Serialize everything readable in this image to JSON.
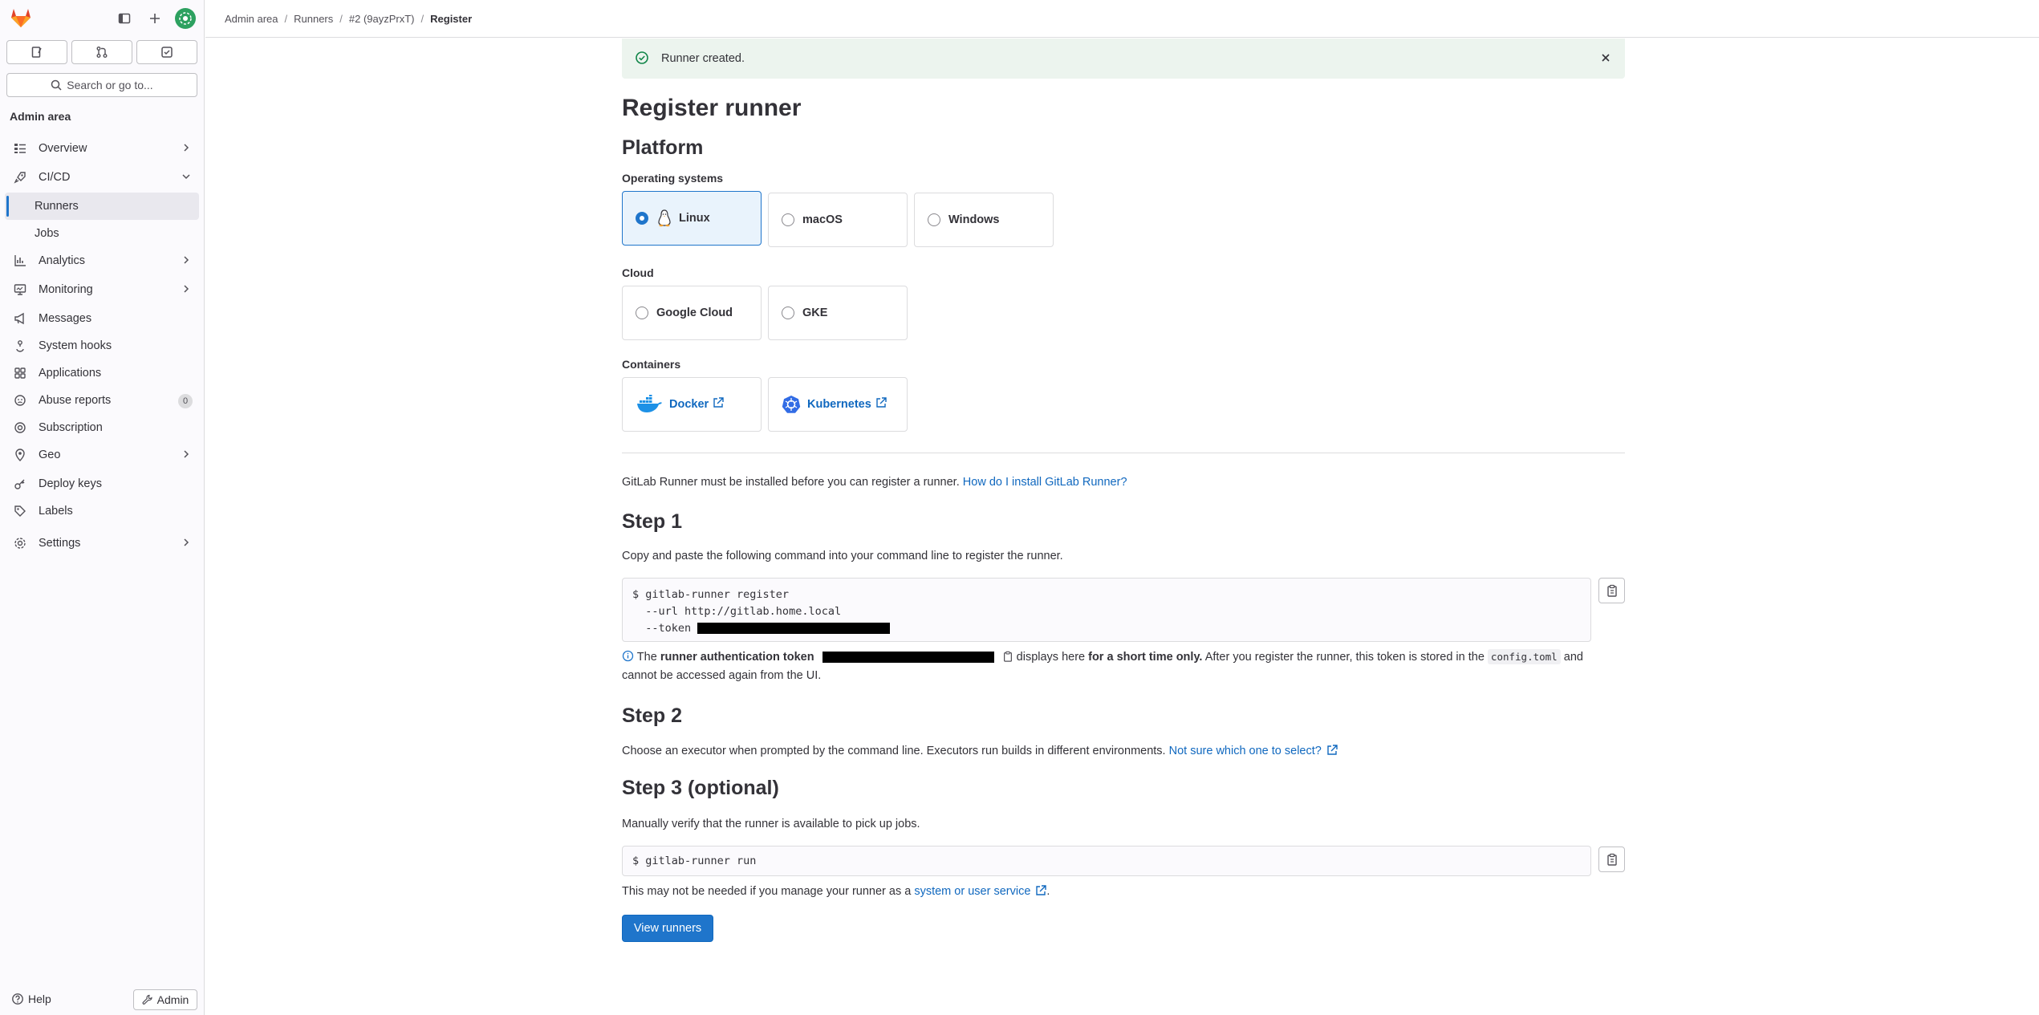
{
  "sidebar": {
    "section_title": "Admin area",
    "search_placeholder": "Search or go to...",
    "items": [
      {
        "label": "Overview"
      },
      {
        "label": "CI/CD"
      },
      {
        "label": "Runners"
      },
      {
        "label": "Jobs"
      },
      {
        "label": "Analytics"
      },
      {
        "label": "Monitoring"
      },
      {
        "label": "Messages"
      },
      {
        "label": "System hooks"
      },
      {
        "label": "Applications"
      },
      {
        "label": "Abuse reports",
        "badge": "0"
      },
      {
        "label": "Subscription"
      },
      {
        "label": "Geo"
      },
      {
        "label": "Deploy keys"
      },
      {
        "label": "Labels"
      },
      {
        "label": "Settings"
      }
    ],
    "help_label": "Help",
    "admin_label": "Admin"
  },
  "breadcrumb": {
    "items": [
      "Admin area",
      "Runners",
      "#2 (9ayzPrxT)",
      "Register"
    ]
  },
  "alert": {
    "message": "Runner created."
  },
  "page": {
    "title": "Register runner",
    "platform_heading": "Platform",
    "os_label": "Operating systems",
    "os_options": [
      "Linux",
      "macOS",
      "Windows"
    ],
    "os_selected": "Linux",
    "cloud_label": "Cloud",
    "cloud_options": [
      "Google Cloud",
      "GKE"
    ],
    "containers_label": "Containers",
    "container_options": [
      "Docker",
      "Kubernetes"
    ],
    "install_note": "GitLab Runner must be installed before you can register a runner.",
    "install_link": "How do I install GitLab Runner?",
    "step1": {
      "heading": "Step 1",
      "desc": "Copy and paste the following command into your command line to register the runner.",
      "cmd_line1": "$ gitlab-runner register",
      "cmd_line2": "  --url http://gitlab.home.local",
      "cmd_line3": "  --token",
      "token_pre": "The",
      "token_bold": "runner authentication token",
      "token_mid": "displays here",
      "token_bold2": "for a short time only.",
      "token_post": "After you register the runner, this token is stored in the",
      "token_code": "config.toml",
      "token_end": "and",
      "token_line2": "cannot be accessed again from the UI."
    },
    "step2": {
      "heading": "Step 2",
      "desc": "Choose an executor when prompted by the command line. Executors run builds in different environments.",
      "link": "Not sure which one to select?"
    },
    "step3": {
      "heading": "Step 3 (optional)",
      "desc": "Manually verify that the runner is available to pick up jobs.",
      "cmd": "$ gitlab-runner run",
      "note": "This may not be needed if you manage your runner as a",
      "note_link": "system or user service",
      "note_end": "."
    },
    "view_runners_label": "View runners"
  },
  "colors": {
    "accent": "#1f75cb",
    "link": "#1068bf",
    "success_bg": "#ecf4ee",
    "success_icon": "#108548"
  }
}
